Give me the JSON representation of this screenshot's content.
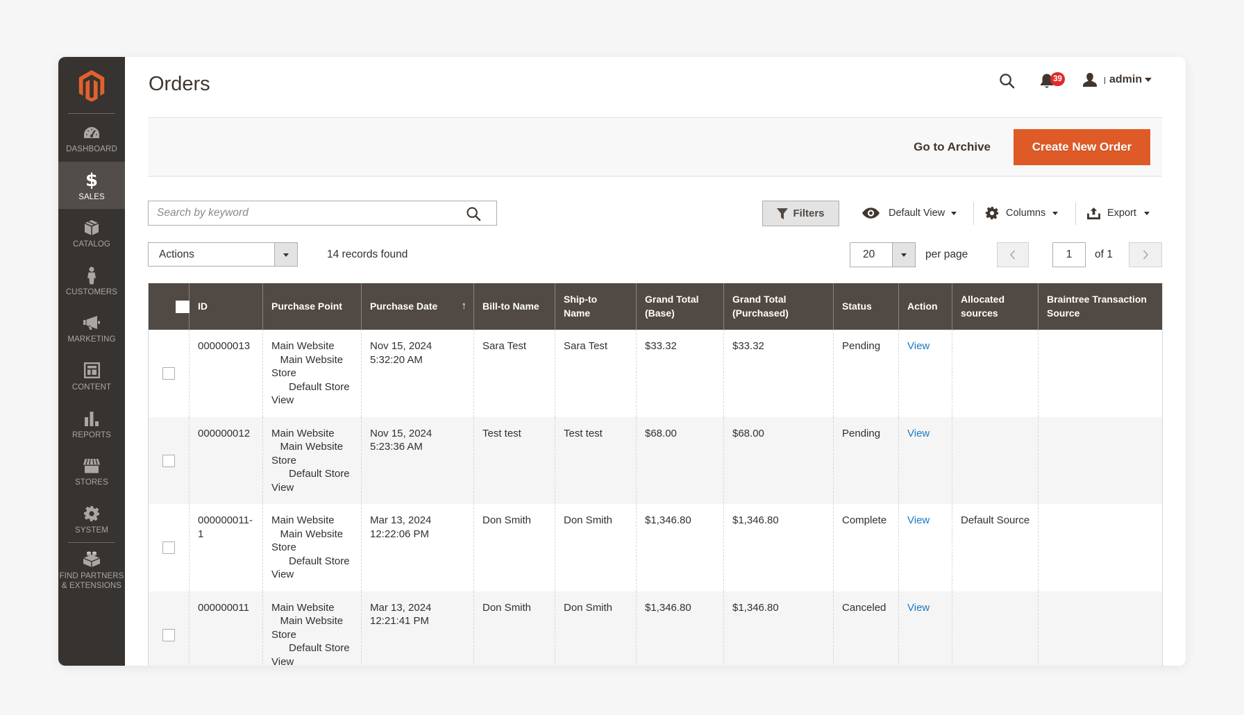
{
  "sidebar": {
    "logo_icon": "magento-logo",
    "items": [
      {
        "label": "DASHBOARD",
        "icon": "dashboard-gauge-icon",
        "active": false
      },
      {
        "label": "SALES",
        "icon": "dollar-icon",
        "active": true
      },
      {
        "label": "CATALOG",
        "icon": "box-icon",
        "active": false
      },
      {
        "label": "CUSTOMERS",
        "icon": "person-icon",
        "active": false
      },
      {
        "label": "MARKETING",
        "icon": "megaphone-icon",
        "active": false
      },
      {
        "label": "CONTENT",
        "icon": "layout-icon",
        "active": false
      },
      {
        "label": "REPORTS",
        "icon": "bar-chart-icon",
        "active": false
      },
      {
        "label": "STORES",
        "icon": "storefront-icon",
        "active": false
      },
      {
        "label": "SYSTEM",
        "icon": "gear-icon",
        "active": false
      },
      {
        "label": "FIND PARTNERS\n& EXTENSIONS",
        "icon": "lego-brick-icon",
        "active": false
      }
    ]
  },
  "header": {
    "title": "Orders",
    "notifications_count": "39",
    "user_name": "admin"
  },
  "action_bar": {
    "archive_label": "Go to Archive",
    "create_label": "Create New Order"
  },
  "toolbar": {
    "search_placeholder": "Search by keyword",
    "search_value": "",
    "filters_label": "Filters",
    "view_label": "Default View",
    "columns_label": "Columns",
    "export_label": "Export",
    "actions_label": "Actions",
    "records_found": "14 records found",
    "per_page_value": "20",
    "per_page_label": "per page",
    "page_value": "1",
    "page_total": "of 1"
  },
  "table": {
    "sort": {
      "column": "Purchase Date",
      "direction": "ascending",
      "indicator": "↑"
    },
    "columns": [
      {
        "label": "ID"
      },
      {
        "label": "Purchase Point"
      },
      {
        "label": "Purchase Date"
      },
      {
        "label": "Bill-to Name"
      },
      {
        "label": "Ship-to\nName"
      },
      {
        "label": "Grand Total\n(Base)"
      },
      {
        "label": "Grand Total\n(Purchased)"
      },
      {
        "label": "Status"
      },
      {
        "label": "Action"
      },
      {
        "label": "Allocated\nsources"
      },
      {
        "label": "Braintree Transaction\nSource"
      }
    ],
    "rows": [
      {
        "id": "000000013",
        "purchase_point": [
          "Main Website",
          "   Main Website",
          "Store",
          "      Default Store",
          "View"
        ],
        "purchase_date": {
          "date": "Nov 15, 2024",
          "time": "5:32:20 AM"
        },
        "bill_to": "Sara Test",
        "ship_to": "Sara Test",
        "grand_total_base": "$33.32",
        "grand_total_purchased": "$33.32",
        "status": "Pending",
        "action": "View",
        "allocated_sources": "",
        "braintree_source": ""
      },
      {
        "id": "000000012",
        "purchase_point": [
          "Main Website",
          "   Main Website",
          "Store",
          "      Default Store",
          "View"
        ],
        "purchase_date": {
          "date": "Nov 15, 2024",
          "time": "5:23:36 AM"
        },
        "bill_to": "Test test",
        "ship_to": "Test test",
        "grand_total_base": "$68.00",
        "grand_total_purchased": "$68.00",
        "status": "Pending",
        "action": "View",
        "allocated_sources": "",
        "braintree_source": ""
      },
      {
        "id": "000000011-1",
        "purchase_point": [
          "Main Website",
          "   Main Website",
          "Store",
          "      Default Store",
          "View"
        ],
        "purchase_date": {
          "date": "Mar 13, 2024",
          "time": "12:22:06 PM"
        },
        "bill_to": "Don Smith",
        "ship_to": "Don Smith",
        "grand_total_base": "$1,346.80",
        "grand_total_purchased": "$1,346.80",
        "status": "Complete",
        "action": "View",
        "allocated_sources": "Default Source",
        "braintree_source": ""
      },
      {
        "id": "000000011",
        "purchase_point": [
          "Main Website",
          "   Main Website",
          "Store",
          "      Default Store",
          "View"
        ],
        "purchase_date": {
          "date": "Mar 13, 2024",
          "time": "12:21:41 PM"
        },
        "bill_to": "Don Smith",
        "ship_to": "Don Smith",
        "grand_total_base": "$1,346.80",
        "grand_total_purchased": "$1,346.80",
        "status": "Canceled",
        "action": "View",
        "allocated_sources": "",
        "braintree_source": ""
      }
    ]
  },
  "colors": {
    "sidebar_bg": "#373330",
    "sidebar_active_bg": "#524d49",
    "brand_orange": "#de5b27",
    "table_header_bg": "#514943",
    "link_blue": "#1979c3",
    "badge_red": "#e02b27"
  }
}
